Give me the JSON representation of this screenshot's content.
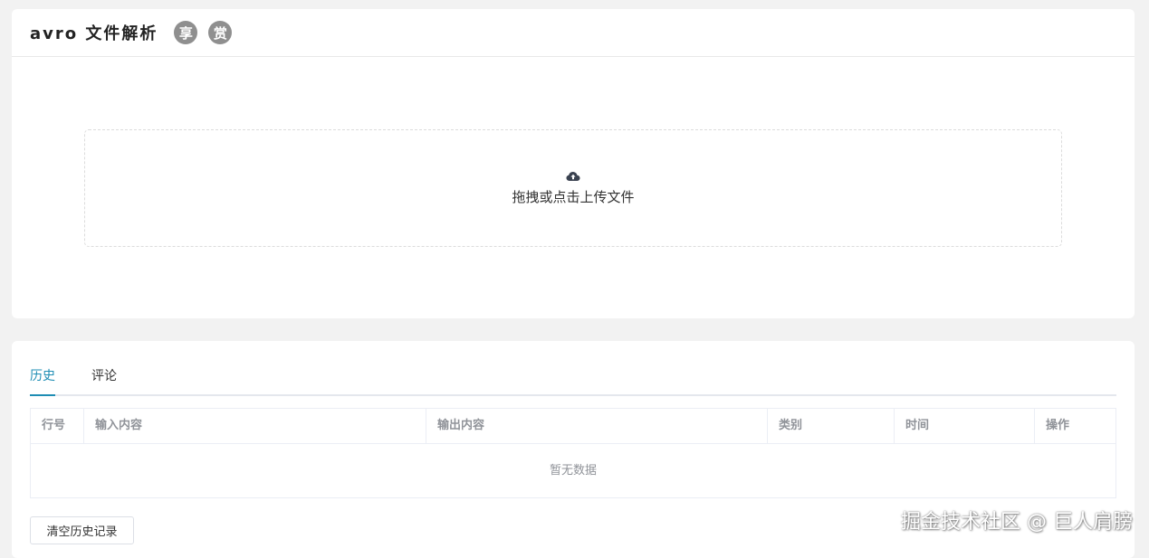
{
  "header": {
    "title": "avro 文件解析",
    "share_badge": "享",
    "reward_badge": "赏"
  },
  "upload": {
    "icon": "cloud-upload-icon",
    "text": "拖拽或点击上传文件"
  },
  "tabs": [
    {
      "label": "历史",
      "active": true
    },
    {
      "label": "评论",
      "active": false
    }
  ],
  "table": {
    "columns": [
      "行号",
      "输入内容",
      "输出内容",
      "类别",
      "时间",
      "操作"
    ],
    "empty_text": "暂无数据"
  },
  "actions": {
    "clear_history": "清空历史记录"
  },
  "watermark": "掘金技术社区 @ 巨人肩膀",
  "colors": {
    "accent": "#1e8db4",
    "badge": "#8f8f8f",
    "background": "#f2f2f2"
  }
}
